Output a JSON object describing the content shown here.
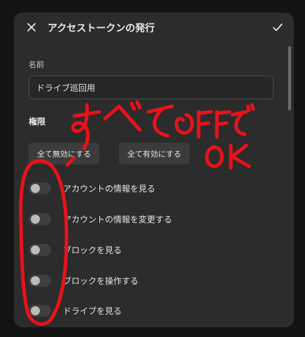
{
  "dialog": {
    "title": "アクセストークンの発行",
    "close_icon": "close-icon",
    "confirm_icon": "checkmark-icon"
  },
  "name_field": {
    "label": "名前",
    "value": "ドライブ巡回用"
  },
  "permissions": {
    "label": "権限",
    "disable_all_label": "全て無効にする",
    "enable_all_label": "全て有効にする",
    "items": [
      {
        "label": "アカウントの情報を見る",
        "enabled": false
      },
      {
        "label": "アカウントの情報を変更する",
        "enabled": false
      },
      {
        "label": "ブロックを見る",
        "enabled": false
      },
      {
        "label": "ブロックを操作する",
        "enabled": false
      },
      {
        "label": "ドライブを見る",
        "enabled": false
      }
    ]
  },
  "annotation": {
    "line1": "すべてOFFで",
    "line2": "OK",
    "color": "#e8121a"
  },
  "colors": {
    "dialog_bg": "#2b2c2b",
    "toggle_off": "#3e3f3e",
    "knob": "#b9bdb6"
  }
}
